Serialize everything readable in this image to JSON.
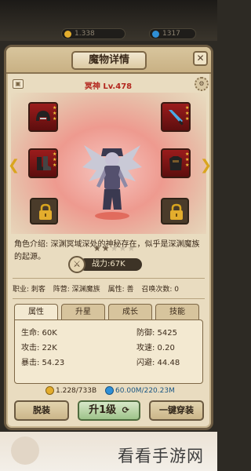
{
  "top_bar": {
    "resource_1": "1.338",
    "resource_2": "1317"
  },
  "header": {
    "title": "魔物详情",
    "close_label": "✕"
  },
  "monster": {
    "name_level": "冥神 Lv.478",
    "star_count": 2,
    "star_total": 5,
    "power_label": "战力:67K",
    "description": "角色介绍: 深渊冥域深处的神秘存在，似乎是深渊魔族的起源。"
  },
  "meta": {
    "job": "职业: 刺客",
    "camp": "阵营: 深渊魔族",
    "attribute": "属性: 善",
    "summons": "召唤次数: 0"
  },
  "tabs": [
    {
      "label": "属性"
    },
    {
      "label": "升星"
    },
    {
      "label": "成长"
    },
    {
      "label": "技能"
    }
  ],
  "stats": {
    "hp": "生命: 60K",
    "atk": "攻击: 22K",
    "crit": "暴击: 54.23",
    "def": "防御: 5425",
    "atk_speed": "攻速: 0.20",
    "dodge": "闪避: 44.48"
  },
  "costs": {
    "gold": "1.228/733B",
    "gem": "60.00M/220.23M"
  },
  "buttons": {
    "unequip": "脱装",
    "level_up": "升1级",
    "equip_all": "一键穿装"
  },
  "watermark": {
    "text": "看看手游网"
  },
  "colors": {
    "panel_bg": "#e9dcc0",
    "stage_glow": "#ee9a8f",
    "equip_slot": "#9b1c1c",
    "name_red": "#b3261e",
    "level_button": "#9ec38a"
  }
}
